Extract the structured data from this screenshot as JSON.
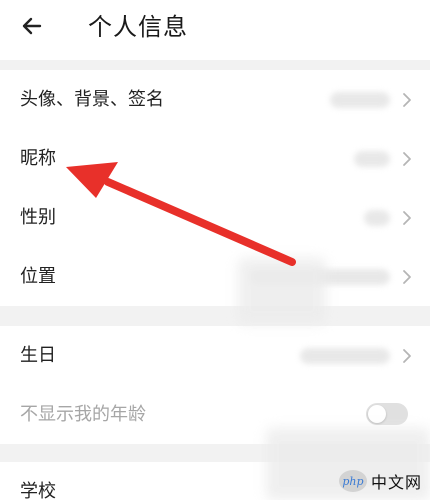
{
  "header": {
    "title": "个人信息",
    "back_icon": "back-arrow-icon"
  },
  "section1": {
    "items": [
      {
        "label": "头像、背景、签名",
        "has_chevron": true
      },
      {
        "label": "昵称",
        "has_chevron": true
      },
      {
        "label": "性别",
        "has_chevron": true
      },
      {
        "label": "位置",
        "has_chevron": true
      }
    ]
  },
  "section2": {
    "items": [
      {
        "label": "生日",
        "has_chevron": true
      },
      {
        "label": "不显示我的年龄",
        "toggle": false
      }
    ]
  },
  "section3": {
    "items": [
      {
        "label": "学校"
      }
    ]
  },
  "annotation": {
    "type": "red-arrow",
    "points_to": "昵称",
    "color": "#e8302a"
  },
  "watermark": {
    "logo": "php",
    "text": "中文网"
  },
  "colors": {
    "background": "#f2f2f2",
    "row_background": "#ffffff",
    "muted_text": "#a6a6a6",
    "chevron": "#b5b5b5"
  }
}
